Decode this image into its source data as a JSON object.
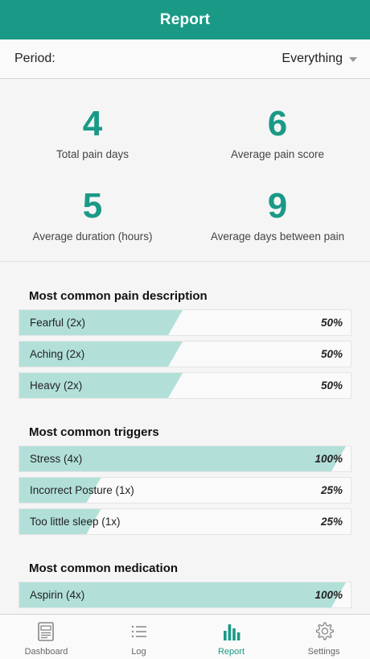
{
  "header": {
    "title": "Report"
  },
  "period": {
    "label": "Period:",
    "value": "Everything"
  },
  "stats": [
    {
      "value": "4",
      "caption": "Total pain days"
    },
    {
      "value": "6",
      "caption": "Average pain score"
    },
    {
      "value": "5",
      "caption": "Average duration (hours)"
    },
    {
      "value": "9",
      "caption": "Average days between pain"
    }
  ],
  "sections": {
    "descriptions": {
      "title": "Most common pain description",
      "items": [
        {
          "label": "Fearful (2x)",
          "percent": "50%",
          "fraction": 0.5
        },
        {
          "label": "Aching (2x)",
          "percent": "50%",
          "fraction": 0.5
        },
        {
          "label": "Heavy (2x)",
          "percent": "50%",
          "fraction": 0.5
        }
      ]
    },
    "triggers": {
      "title": "Most common triggers",
      "items": [
        {
          "label": "Stress (4x)",
          "percent": "100%",
          "fraction": 1.0
        },
        {
          "label": "Incorrect Posture (1x)",
          "percent": "25%",
          "fraction": 0.25
        },
        {
          "label": "Too little sleep (1x)",
          "percent": "25%",
          "fraction": 0.25
        }
      ]
    },
    "medication": {
      "title": "Most common medication",
      "items": [
        {
          "label": "Aspirin (4x)",
          "percent": "100%",
          "fraction": 1.0
        }
      ]
    }
  },
  "nav": [
    {
      "label": "Dashboard",
      "icon": "dashboard-icon",
      "active": false
    },
    {
      "label": "Log",
      "icon": "list-icon",
      "active": false
    },
    {
      "label": "Report",
      "icon": "bar-chart-icon",
      "active": true
    },
    {
      "label": "Settings",
      "icon": "gear-icon",
      "active": false
    }
  ],
  "colors": {
    "accent": "#1a9a86",
    "barFill": "#b2e0d9",
    "inactiveIcon": "#888888"
  }
}
